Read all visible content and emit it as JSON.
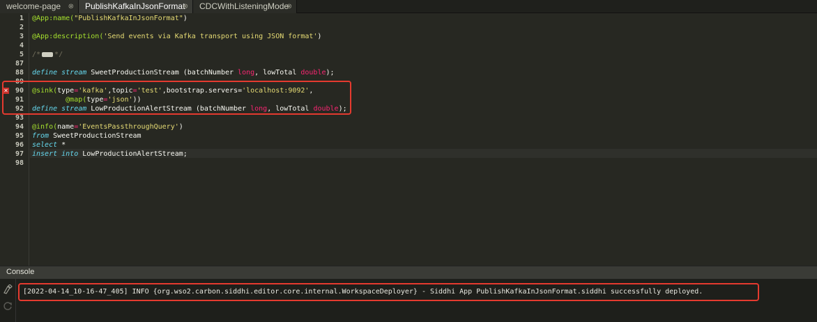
{
  "tabs": [
    {
      "label": "welcome-page",
      "close": "⊗"
    },
    {
      "label": "PublishKafkaInJsonFormat",
      "close": "⊗"
    },
    {
      "label": "CDCWithListeningMode",
      "close": "⊗"
    }
  ],
  "gutter": [
    "1",
    "2",
    "3",
    "4",
    "5",
    "87",
    "88",
    "89",
    "90",
    "91",
    "92",
    "93",
    "94",
    "95",
    "96",
    "97",
    "98"
  ],
  "error_marker": "✕",
  "code": {
    "l1": {
      "a": "@App:name(",
      "b": "\"PublishKafkaInJsonFormat\"",
      "c": ")"
    },
    "l3": {
      "a": "@App:description(",
      "b": "'Send events via Kafka transport using JSON format'",
      "c": ")"
    },
    "l5": {
      "a": "/*",
      "b": "*/"
    },
    "l88": {
      "a": "define stream",
      "b": " SweetProductionStream ",
      "c": "(batchNumber ",
      "d": "long",
      "e": ", lowTotal ",
      "f": "double",
      "g": ");"
    },
    "l90": {
      "a": "@sink(",
      "b": "type",
      "c": "=",
      "d": "'kafka'",
      "e": ",",
      "f": "topic",
      "g": "=",
      "h": "'test'",
      "i": ",bootstrap.servers=",
      "j": "'localhost:9092'",
      "k": ","
    },
    "l91": {
      "a": "        @map(",
      "b": "type",
      "c": "=",
      "d": "'json'",
      "e": "))"
    },
    "l92": {
      "a": "define stream",
      "b": " LowProductionAlertStream ",
      "c": "(batchNumber ",
      "d": "long",
      "e": ", lowTotal ",
      "f": "double",
      "g": ");"
    },
    "l94": {
      "a": "@info(",
      "b": "name",
      "c": "=",
      "d": "'EventsPassthroughQuery'",
      "e": ")"
    },
    "l95": {
      "a": "from",
      "b": " SweetProductionStream"
    },
    "l96": {
      "a": "select",
      "b": " *"
    },
    "l97": {
      "a": "insert into",
      "b": " LowProductionAlertStream;"
    }
  },
  "console": {
    "title": "Console",
    "log": "[2022-04-14_10-16-47_405] INFO {org.wso2.carbon.siddhi.editor.core.internal.WorkspaceDeployer} - Siddhi App PublishKafkaInJsonFormat.siddhi successfully deployed.",
    "icons": [
      "clear-icon",
      "refresh-icon"
    ]
  },
  "colors": {
    "error_highlight": "#e53a2f",
    "background": "#272822"
  }
}
